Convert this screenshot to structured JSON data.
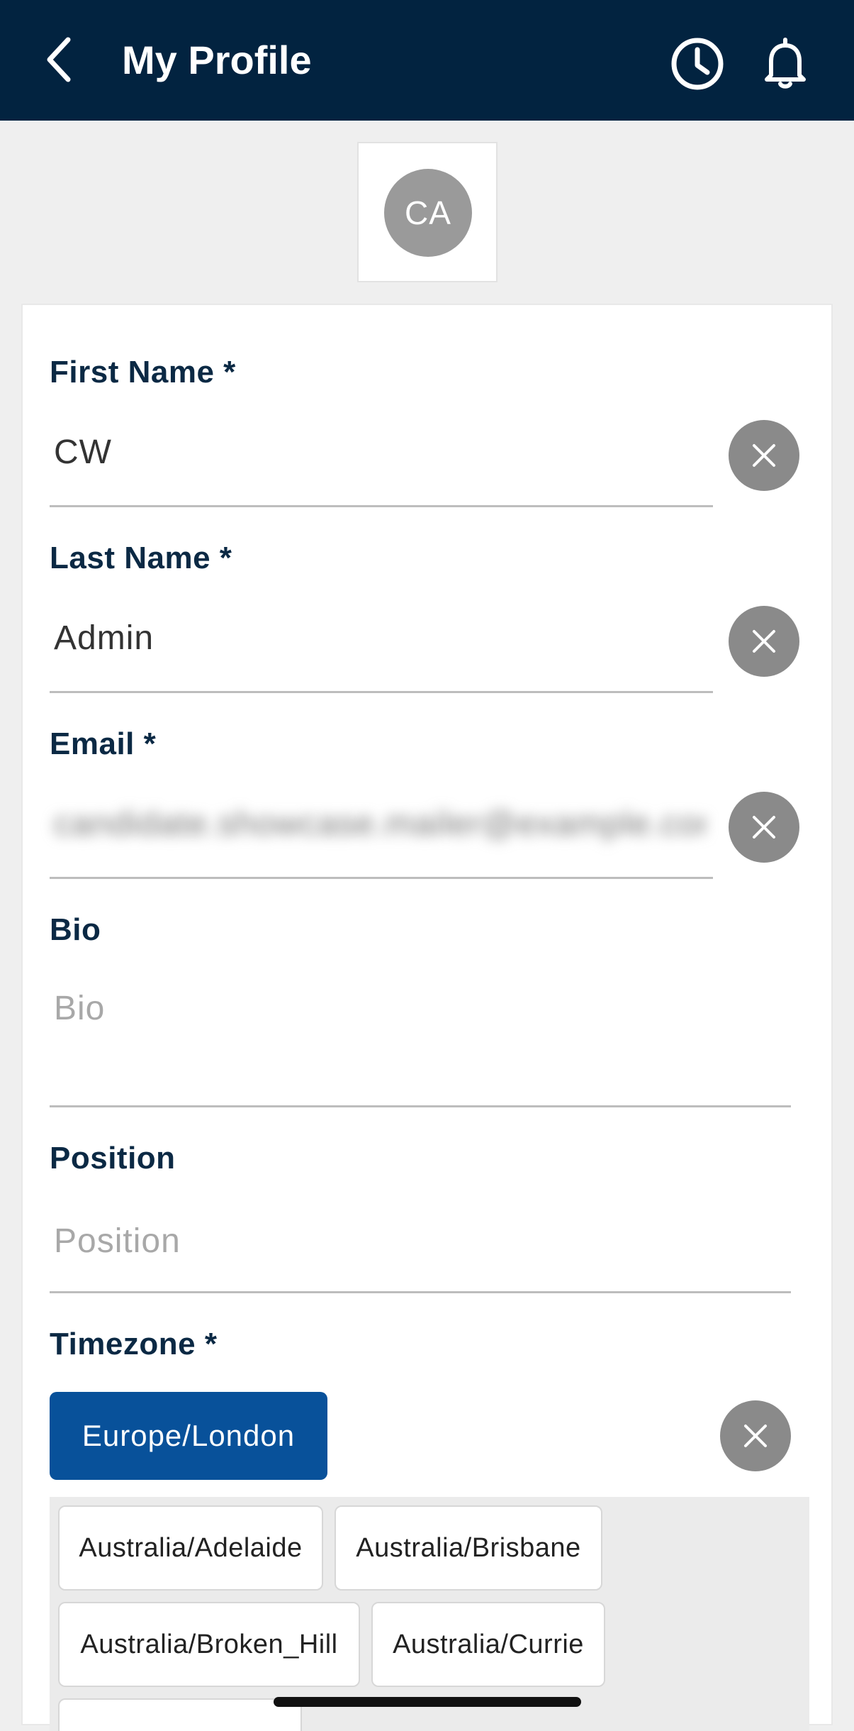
{
  "header": {
    "title": "My Profile",
    "back_icon": "chevron-left-icon",
    "history_icon": "clock-icon",
    "notifications_icon": "bell-icon"
  },
  "avatar": {
    "initials": "CA"
  },
  "form": {
    "first_name": {
      "label": "First Name *",
      "value": "CW"
    },
    "last_name": {
      "label": "Last Name *",
      "value": "Admin"
    },
    "email": {
      "label": "Email *",
      "value": "candidate.showcase.mailer@example.com"
    },
    "bio": {
      "label": "Bio",
      "placeholder": "Bio"
    },
    "position": {
      "label": "Position",
      "placeholder": "Position"
    },
    "timezone": {
      "label": "Timezone *",
      "selected": "Europe/London",
      "options": [
        "Australia/Adelaide",
        "Australia/Brisbane",
        "Australia/Broken_Hill",
        "Australia/Currie",
        ""
      ]
    }
  },
  "colors": {
    "header_bg": "#022340",
    "label": "#0b2944",
    "selected_chip": "#08519a",
    "clear_button": "#8a8a8a"
  }
}
